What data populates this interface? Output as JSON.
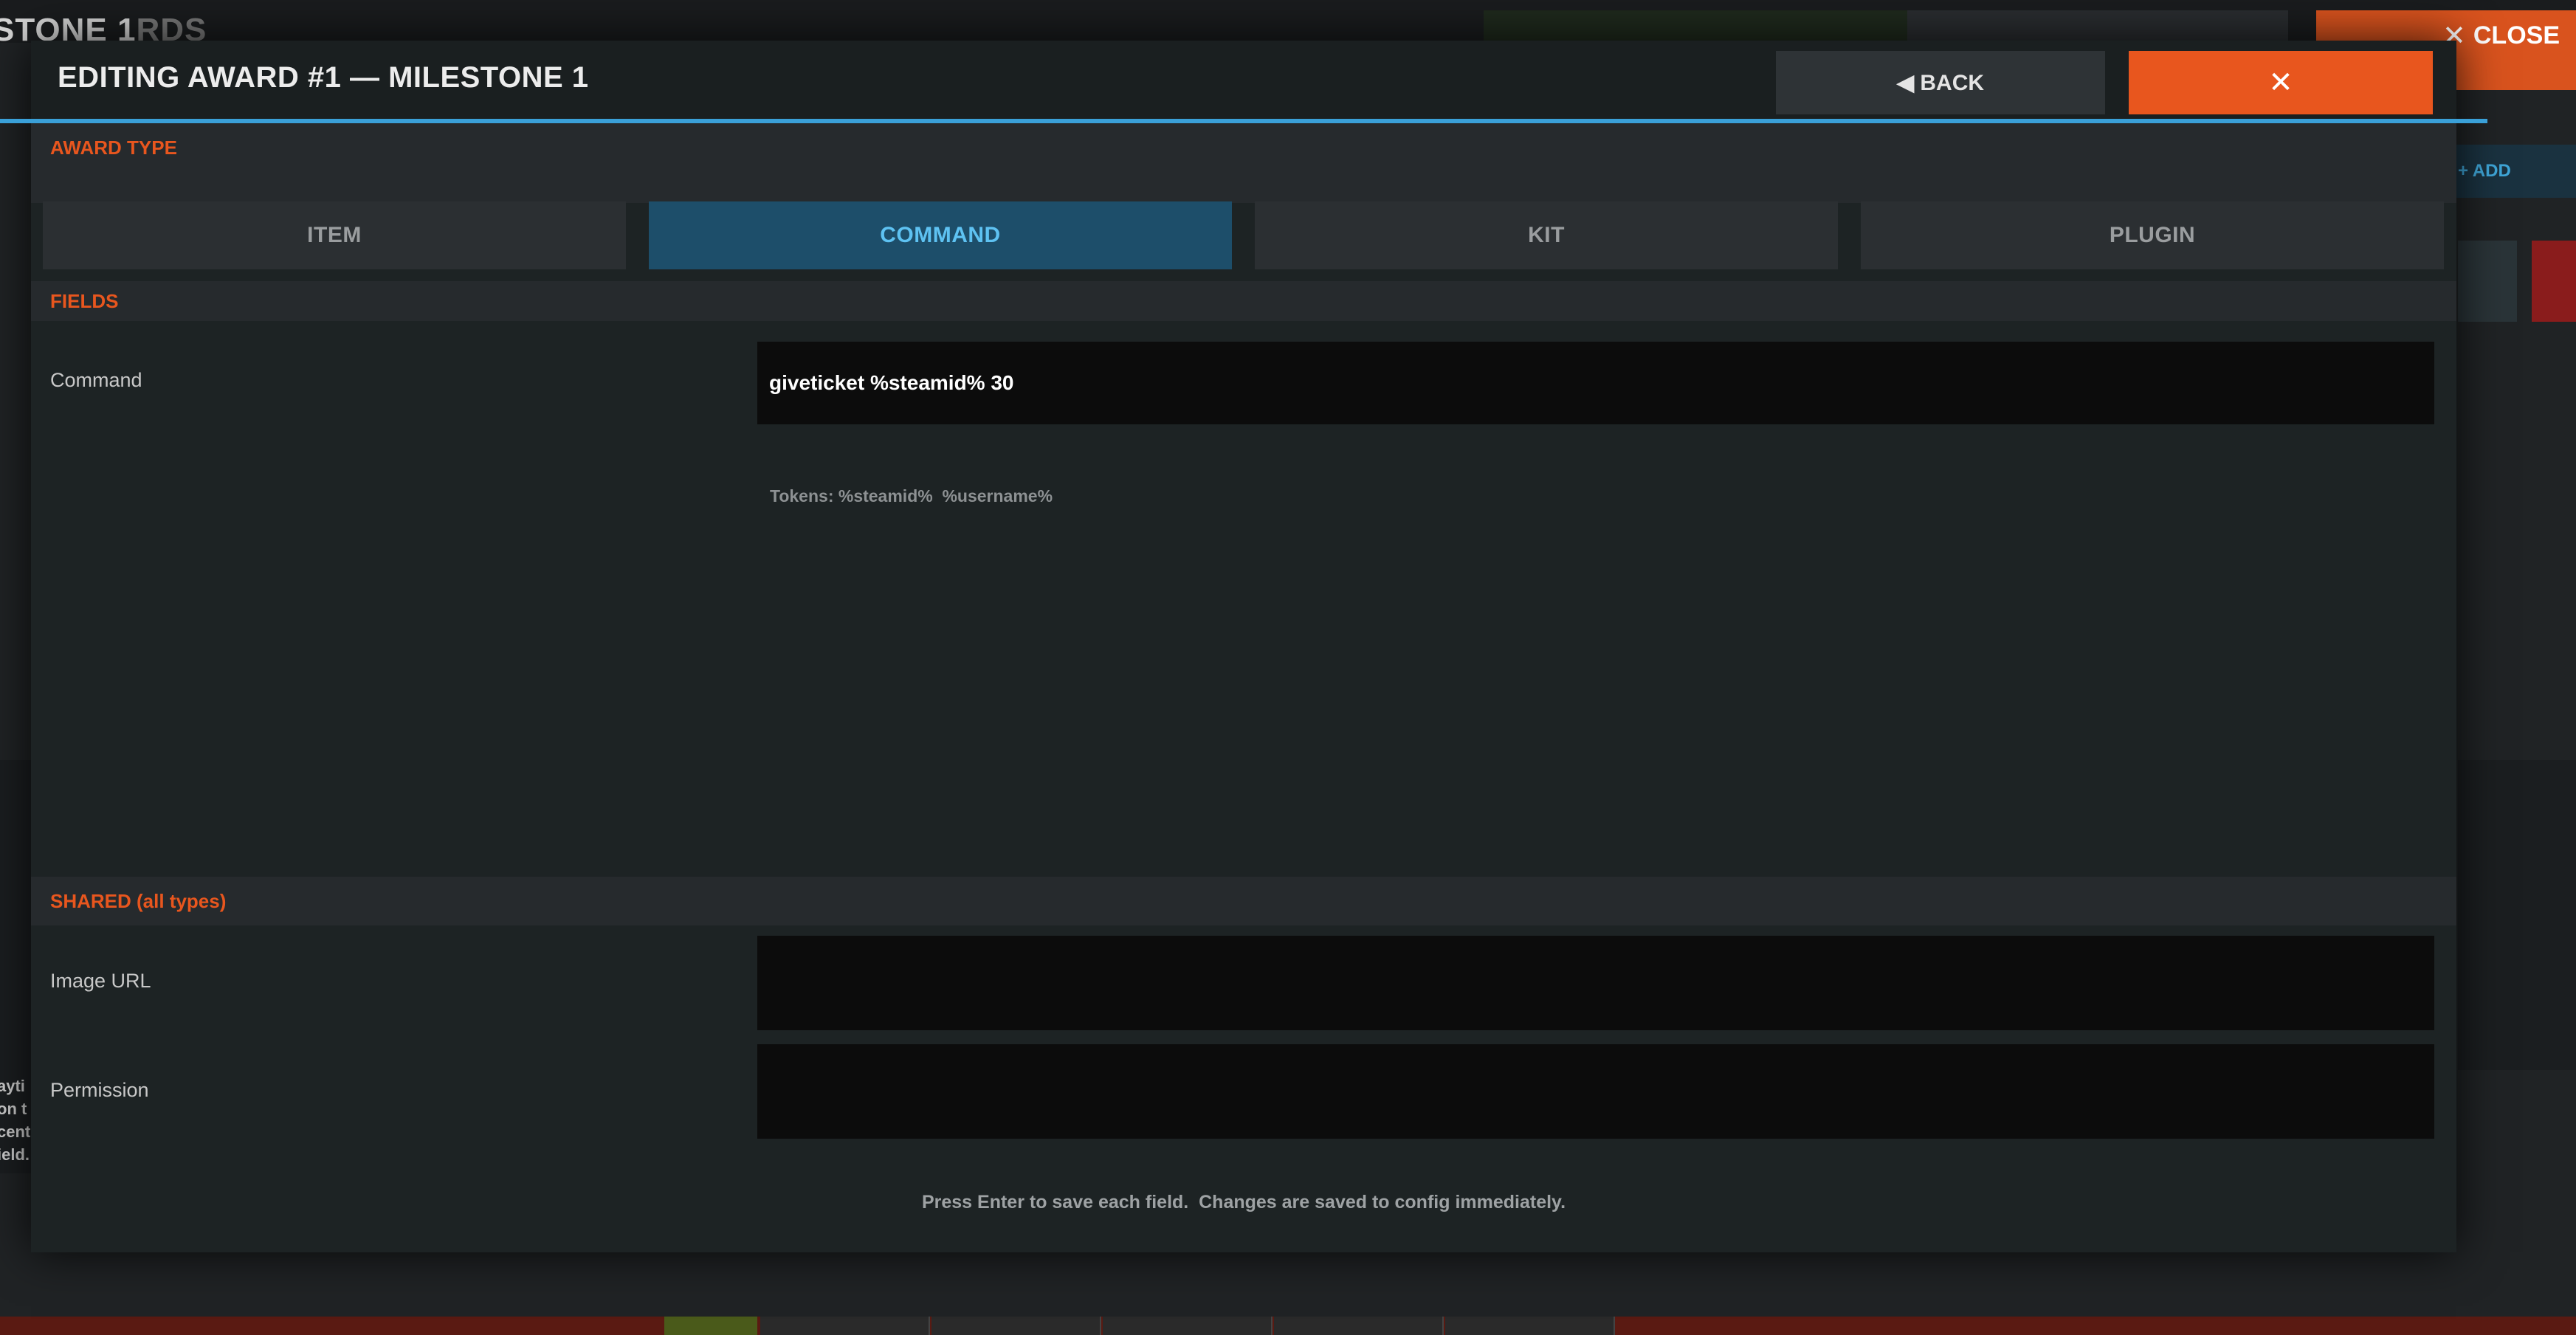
{
  "background": {
    "page_title": "STONE 1",
    "page_title_faded": "RDS",
    "close_label": "CLOSE",
    "add_label": "+ ADD",
    "side_text": [
      "ayti",
      "on t",
      "cent",
      "ield."
    ]
  },
  "modal": {
    "title": "EDITING AWARD #1  —  MILESTONE 1",
    "back_label": "◀ BACK",
    "close_icon": "close-icon",
    "award_type": {
      "heading": "AWARD TYPE",
      "tabs": [
        {
          "label": "ITEM",
          "active": false
        },
        {
          "label": "COMMAND",
          "active": true
        },
        {
          "label": "KIT",
          "active": false
        },
        {
          "label": "PLUGIN",
          "active": false
        }
      ]
    },
    "fields": {
      "heading": "FIELDS",
      "command_label": "Command",
      "command_value": "giveticket %steamid% 30",
      "tokens_hint": "Tokens: %steamid%  %username%"
    },
    "shared": {
      "heading": "SHARED (all types)",
      "image_url_label": "Image URL",
      "image_url_value": "",
      "permission_label": "Permission",
      "permission_value": ""
    },
    "footer_note": "Press Enter to save each field.  Changes are saved to config immediately."
  },
  "colors": {
    "accent_orange": "#e8561e",
    "accent_blue": "#3aa0d8",
    "active_tab_bg": "#1d4e6a",
    "active_tab_text": "#5ec2f2"
  }
}
